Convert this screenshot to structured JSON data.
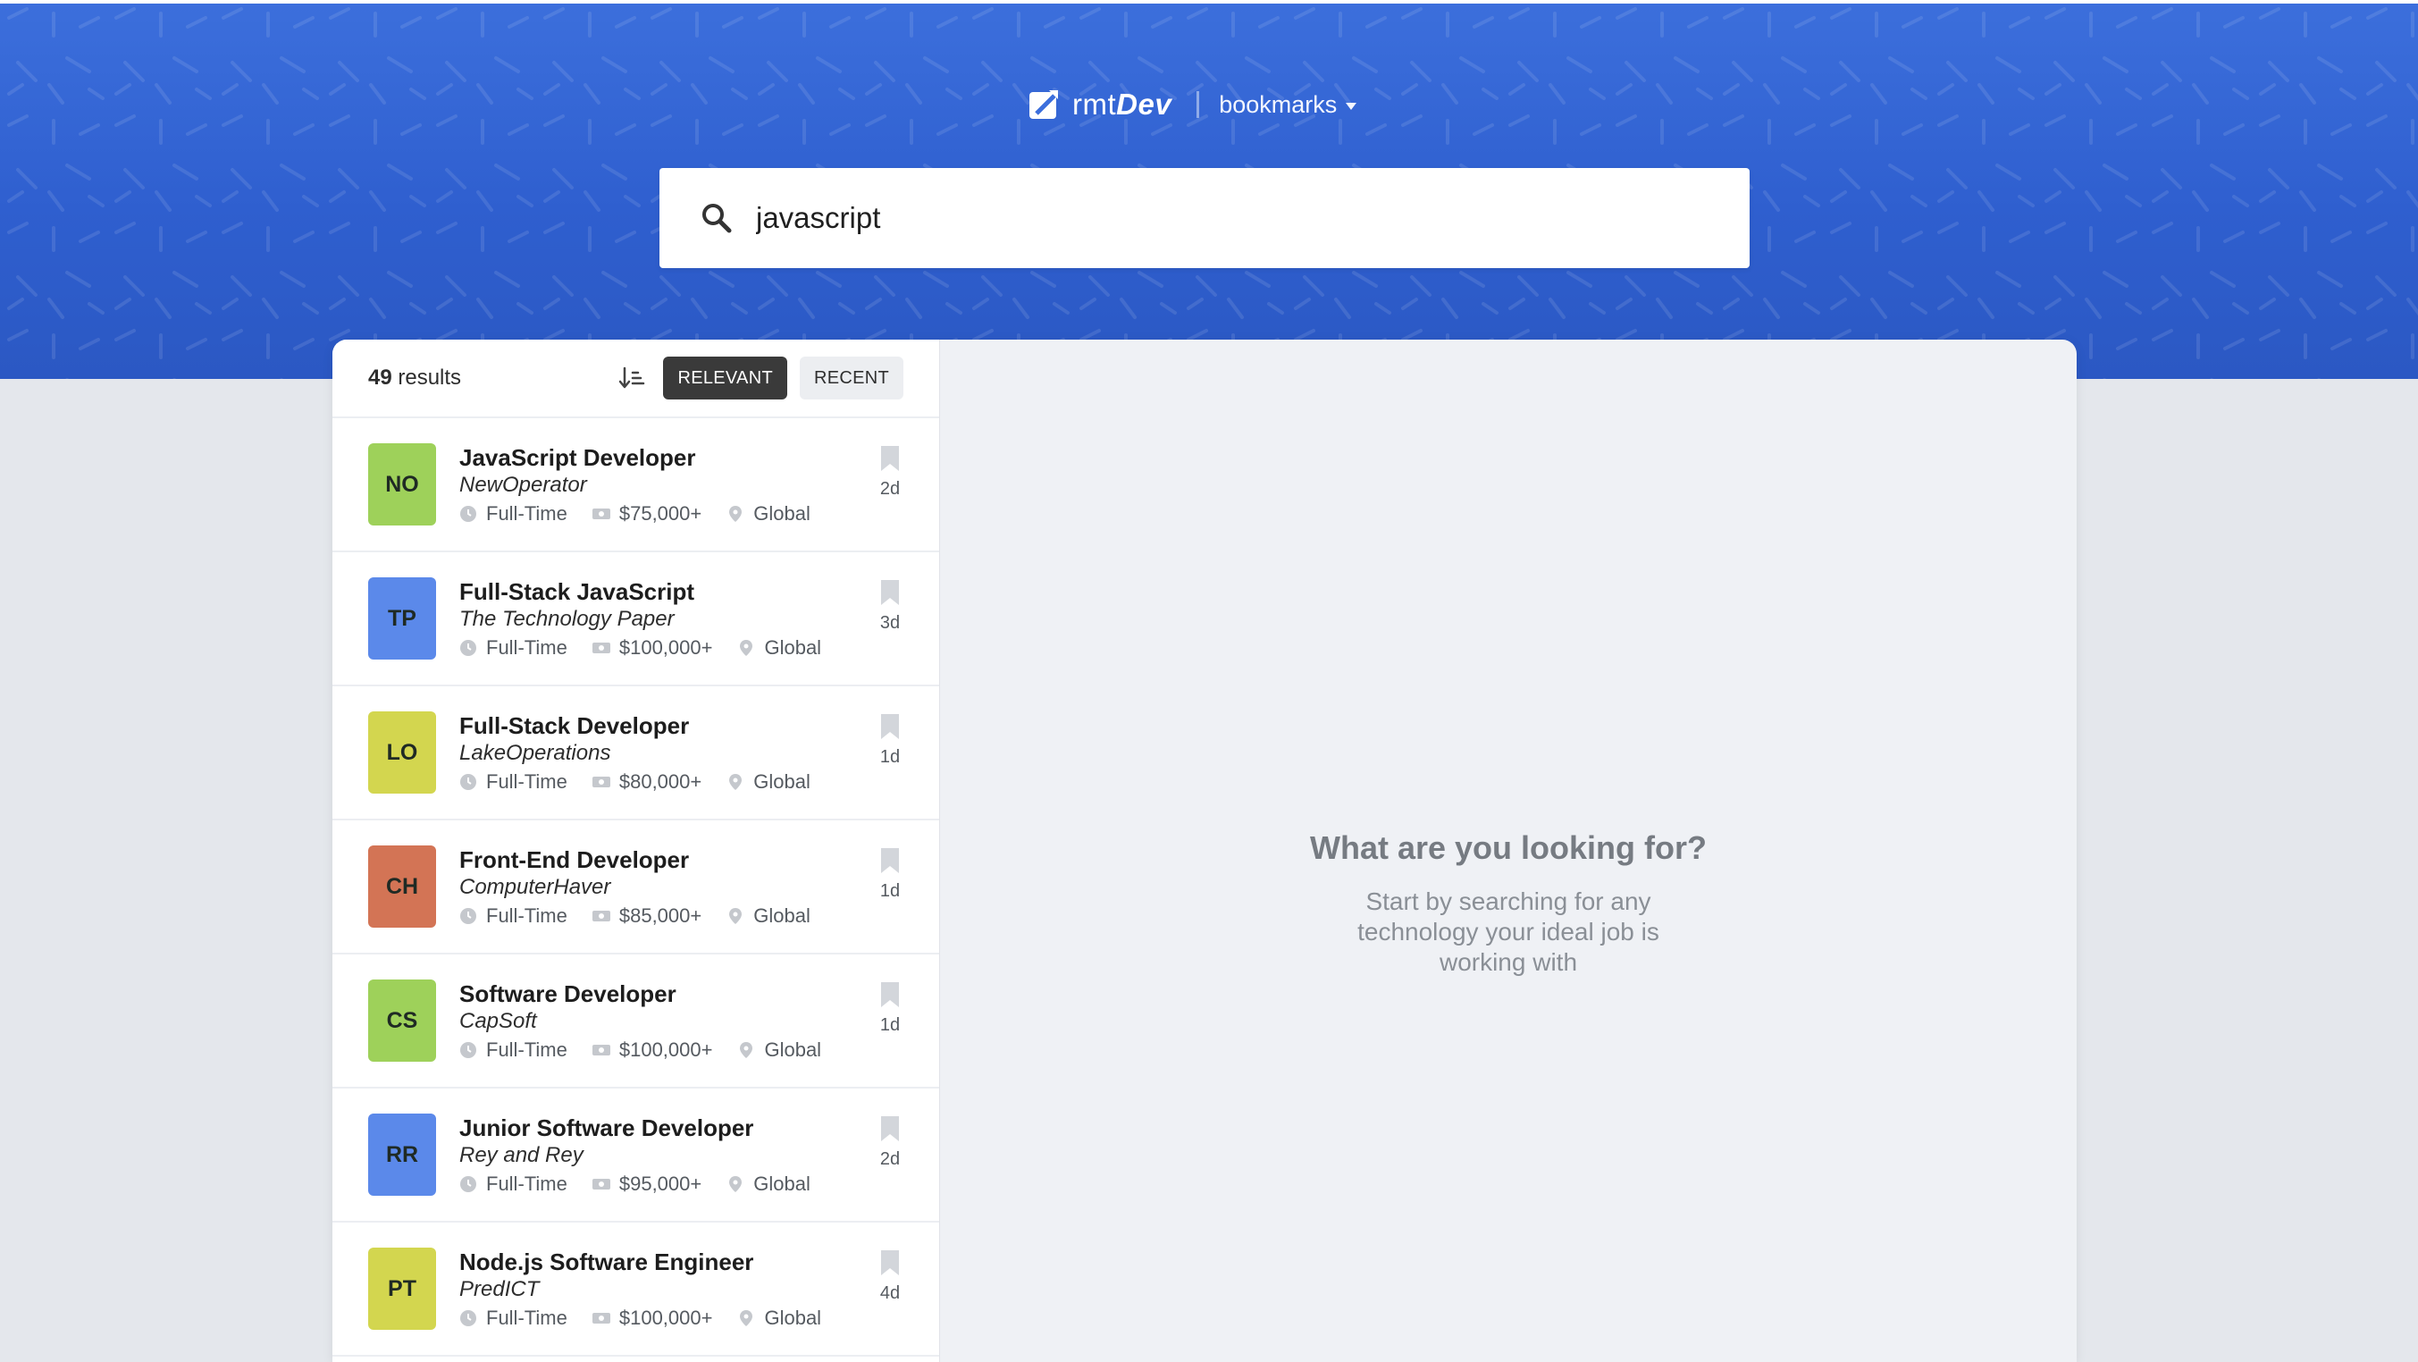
{
  "header": {
    "logo_thin": "rmt",
    "logo_bold": "Dev",
    "bookmarks_label": "bookmarks"
  },
  "search": {
    "value": "javascript",
    "placeholder": "Find remote developer jobs..."
  },
  "results": {
    "count": "49",
    "label": " results",
    "sort_relevant": "RELEVANT",
    "sort_recent": "RECENT"
  },
  "colors": {
    "header_blue": "#3c6fdc",
    "badge_green": "#9ed15a",
    "badge_blue": "#5b89ea",
    "badge_yellow": "#d3d64f",
    "badge_orange": "#d37455"
  },
  "jobs": [
    {
      "badge": "NO",
      "badge_color": "#9ed15a",
      "title": "JavaScript Developer",
      "company": "NewOperator",
      "type": "Full-Time",
      "salary": "$75,000+",
      "location": "Global",
      "age": "2d"
    },
    {
      "badge": "TP",
      "badge_color": "#5b89ea",
      "title": "Full-Stack JavaScript",
      "company": "The Technology Paper",
      "type": "Full-Time",
      "salary": "$100,000+",
      "location": "Global",
      "age": "3d"
    },
    {
      "badge": "LO",
      "badge_color": "#d3d64f",
      "title": "Full-Stack Developer",
      "company": "LakeOperations",
      "type": "Full-Time",
      "salary": "$80,000+",
      "location": "Global",
      "age": "1d"
    },
    {
      "badge": "CH",
      "badge_color": "#d37455",
      "title": "Front-End Developer",
      "company": "ComputerHaver",
      "type": "Full-Time",
      "salary": "$85,000+",
      "location": "Global",
      "age": "1d"
    },
    {
      "badge": "CS",
      "badge_color": "#9ed15a",
      "title": "Software Developer",
      "company": "CapSoft",
      "type": "Full-Time",
      "salary": "$100,000+",
      "location": "Global",
      "age": "1d"
    },
    {
      "badge": "RR",
      "badge_color": "#5b89ea",
      "title": "Junior Software Developer",
      "company": "Rey and Rey",
      "type": "Full-Time",
      "salary": "$95,000+",
      "location": "Global",
      "age": "2d"
    },
    {
      "badge": "PT",
      "badge_color": "#d3d64f",
      "title": "Node.js Software Engineer",
      "company": "PredICT",
      "type": "Full-Time",
      "salary": "$100,000+",
      "location": "Global",
      "age": "4d"
    }
  ],
  "empty_state": {
    "title": "What are you looking for?",
    "text": "Start by searching for any technology your ideal job is working with"
  }
}
